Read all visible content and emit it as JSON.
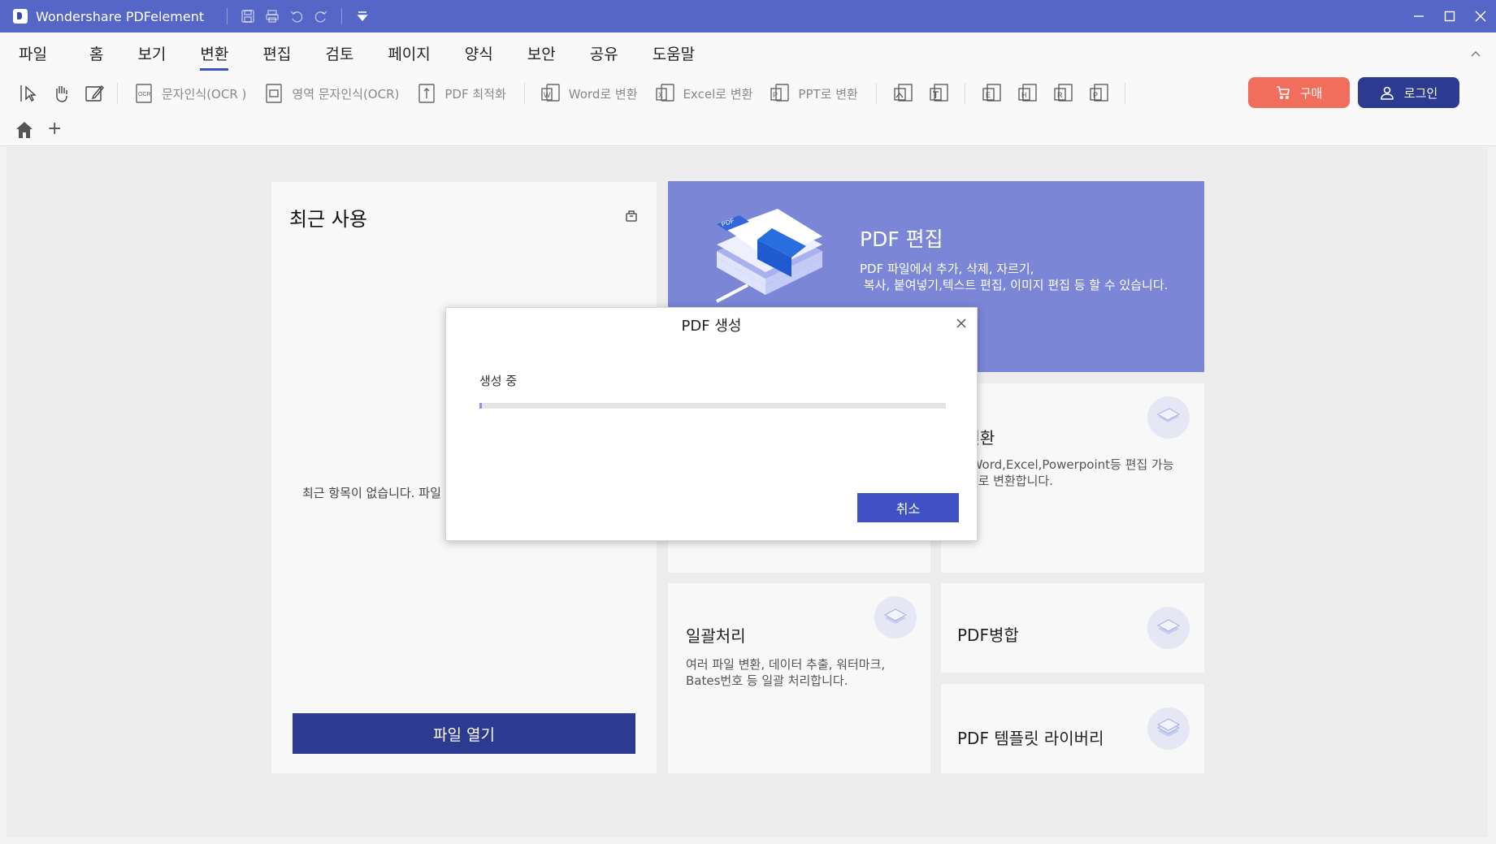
{
  "window": {
    "title": "Wondershare PDFelement"
  },
  "menu": {
    "items": [
      "파일",
      "홈",
      "보기",
      "변환",
      "편집",
      "검토",
      "페이지",
      "양식",
      "보안",
      "공유",
      "도움말"
    ],
    "active_index": 3
  },
  "toolbar": {
    "ocr": "문자인식(OCR )",
    "area_ocr": "영역 문자인식(OCR)",
    "optimize": "PDF 최적화",
    "to_word": "Word로 변환",
    "to_excel": "Excel로 변환",
    "to_ppt": "PPT로 변환",
    "buy": "구매",
    "login": "로그인"
  },
  "recent": {
    "title": "최근 사용",
    "empty": "최근 항목이 없습니다. 파일",
    "open_button": "파일 열기"
  },
  "cards": {
    "edit": {
      "title": "PDF 편집",
      "desc": "PDF 파일에서 추가, 삭제, 자르기,\n 복사, 붙여넣기,텍스트 편집, 이미지 편집 등 할 수 있습니다."
    },
    "convert": {
      "title": "F변환",
      "desc": "를 Word,Excel,Powerpoint등 편집 가능\n문서로 변환합니다."
    },
    "batch": {
      "title": "일괄처리",
      "desc": "여러 파일 변환, 데이터 추출, 워터마크,\nBates번호 등 일괄 처리합니다."
    },
    "merge": {
      "title": "PDF병합"
    },
    "template": {
      "title": "PDF 템플릿 라이버리"
    }
  },
  "dialog": {
    "title": "PDF 생성",
    "status": "생성 중",
    "progress": 0.005,
    "cancel": "취소"
  },
  "colors": {
    "titlebar": "#5666c6",
    "accent": "#3f51c4",
    "primary_button": "#2c3a8f",
    "buy_button": "#f16e5c",
    "edit_card": "#7b86d6"
  }
}
